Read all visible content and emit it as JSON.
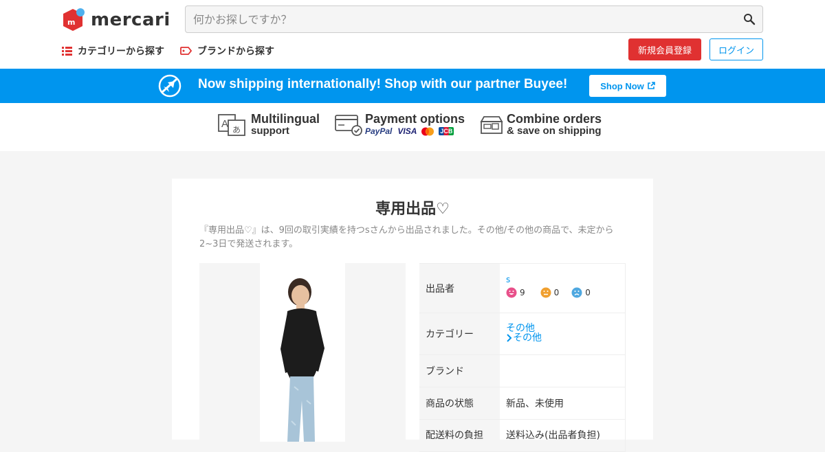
{
  "header": {
    "logo_text": "mercari",
    "search_placeholder": "何かお探しですか？",
    "nav_category": "カテゴリーから探す",
    "nav_brand": "ブランドから探す",
    "signup_label": "新規会員登録",
    "login_label": "ログイン"
  },
  "banner": {
    "text": "Now shipping internationally! Shop with our partner Buyee!",
    "button_label": "Shop Now"
  },
  "features": {
    "multilingual_title": "Multilingual",
    "multilingual_sub": "support",
    "payment_title": "Payment options",
    "payment_paypal": "PayPal",
    "payment_visa": "VISA",
    "payment_jcb": "JCB",
    "combine_title": "Combine orders",
    "combine_sub": "& save on shipping"
  },
  "item": {
    "title": "専用出品♡",
    "description": "『専用出品♡』は、9回の取引実績を持つsさんから出品されました。その他/その他の商品で、未定から2~3日で発送されます。",
    "details": {
      "seller_label": "出品者",
      "seller_name": "s",
      "rating_good": "9",
      "rating_normal": "0",
      "rating_bad": "0",
      "category_label": "カテゴリー",
      "category_1": "その他",
      "category_2": "その他",
      "brand_label": "ブランド",
      "brand_value": "",
      "condition_label": "商品の状態",
      "condition_value": "新品、未使用",
      "shipping_label": "配送料の負担",
      "shipping_value": "送料込み(出品者負担)"
    }
  },
  "colors": {
    "brand_red": "#e03131",
    "link_blue": "#0095ee",
    "good_pink": "#e8508a",
    "normal_orange": "#f0a030",
    "bad_blue": "#4fa8e0"
  }
}
